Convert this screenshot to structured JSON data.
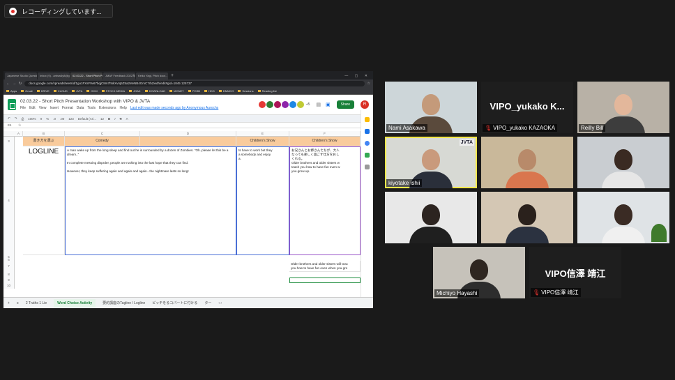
{
  "recording": {
    "label": "レコーディングしています..."
  },
  "browser": {
    "tabs": [
      "Japanese Studio Questionnaire",
      "Inbox (9) - arbsw6y8@gmail.com",
      "02.03.22 - Short Pitch Presenta...",
      "JMAF Feedback 2022年3・2月",
      "Keiko Yagi, Pitch docs - Goog..."
    ],
    "url": "docs.google.com/spreadsheets/d/1gu1FXsF9v67bqjC8m7h5kXvIq5Z5a2MvNB4GmC7rbZiedh/edit#gid=1845 125737",
    "bookmarks": [
      "Apps",
      "Gmail",
      "DRIVE",
      "CLOUD",
      "JVTA",
      "OCM",
      "STOCK MEDIA",
      "JOAK",
      "DOWNLOAD",
      "MONEY",
      "POSB",
      "HDG",
      "DMMCO",
      "Sessions",
      "Reading list"
    ]
  },
  "doc": {
    "title": "02.03.22 - Short Pitch Presentation Workshop with VIPO & JVTA",
    "menu": [
      "File",
      "Edit",
      "View",
      "Insert",
      "Format",
      "Data",
      "Tools",
      "Extensions",
      "Help"
    ],
    "last_edit": "Last edit was made seconds ago by Anonymous Aurochs",
    "share": "Share",
    "account_initial": "R",
    "avatar_colors": [
      "#e53935",
      "#2e7d32",
      "#ad1457",
      "#8e24aa",
      "#1e88e5",
      "#c0ca33"
    ],
    "avatar_more": "+5",
    "toolbar": [
      "100%",
      "¥",
      "%",
      ".0",
      ".00",
      "123",
      "Default (Ari...",
      "12",
      "B",
      "I",
      "S",
      "A"
    ],
    "name_box": "E4"
  },
  "sheet": {
    "col_letters": [
      "A",
      "B",
      "C",
      "D",
      "E",
      "F"
    ],
    "row_numbers": [
      "3",
      "4",
      "5",
      "6",
      "7",
      "8",
      "9",
      "10"
    ],
    "header_row": {
      "b": "書き方を選ぶ",
      "c": "Comedy",
      "e": "Children's Show",
      "f": "Children's Show"
    },
    "logline": "LOGLINE",
    "comedy_text": "A man wake up from the long sleep and find out he is surrounded by a dozen of Zombies. \"Oh..please let this be a dream..\"\n\nIn complete messing disprder, people are rushing into the last hope that they can find.\n\nHowever, they keep suffering again and again and again...the nightmare lasts so long!",
    "children_e_text": "ts have to work but they\na somebody and enjoy\na.",
    "children_f_text": "お兄さんとお姉さんたちが、大人\nなっても楽しく過ごす仕方をおし\nくれる。\nOlder brothers and older sisters w\nteach you how to have fun even w\nyou grow up.",
    "row7_f_text": "Older brothers and older sisters will teac\nyou how to have fun even when you gro"
  },
  "sheet_tabs": [
    "2 Truths 1 Lie",
    "Word Choice Activity",
    "要約講座のTagline / Logline",
    "ピッチをるコパートに付ける",
    "ター"
  ],
  "participants": [
    {
      "name": "Nami Asakawa",
      "type": "video"
    },
    {
      "name": "VIPO_yukako KAZAOKA",
      "big_label": "VIPO_yukako K...",
      "type": "label",
      "muted": true
    },
    {
      "name": "Reilly Bill",
      "type": "video"
    },
    {
      "name": "kiyotake ishii",
      "type": "video",
      "speaking": true,
      "badge": "JVTA"
    },
    {
      "name": "",
      "type": "video"
    },
    {
      "name": "",
      "type": "video"
    },
    {
      "name": "",
      "type": "video"
    },
    {
      "name": "",
      "type": "video"
    },
    {
      "name": "",
      "type": "video"
    },
    {
      "name": "Michiyo Hayashi",
      "type": "video"
    },
    {
      "name": "VIPO信澤 靖江",
      "big_label": "VIPO信澤 靖江",
      "type": "label",
      "muted": true
    }
  ]
}
